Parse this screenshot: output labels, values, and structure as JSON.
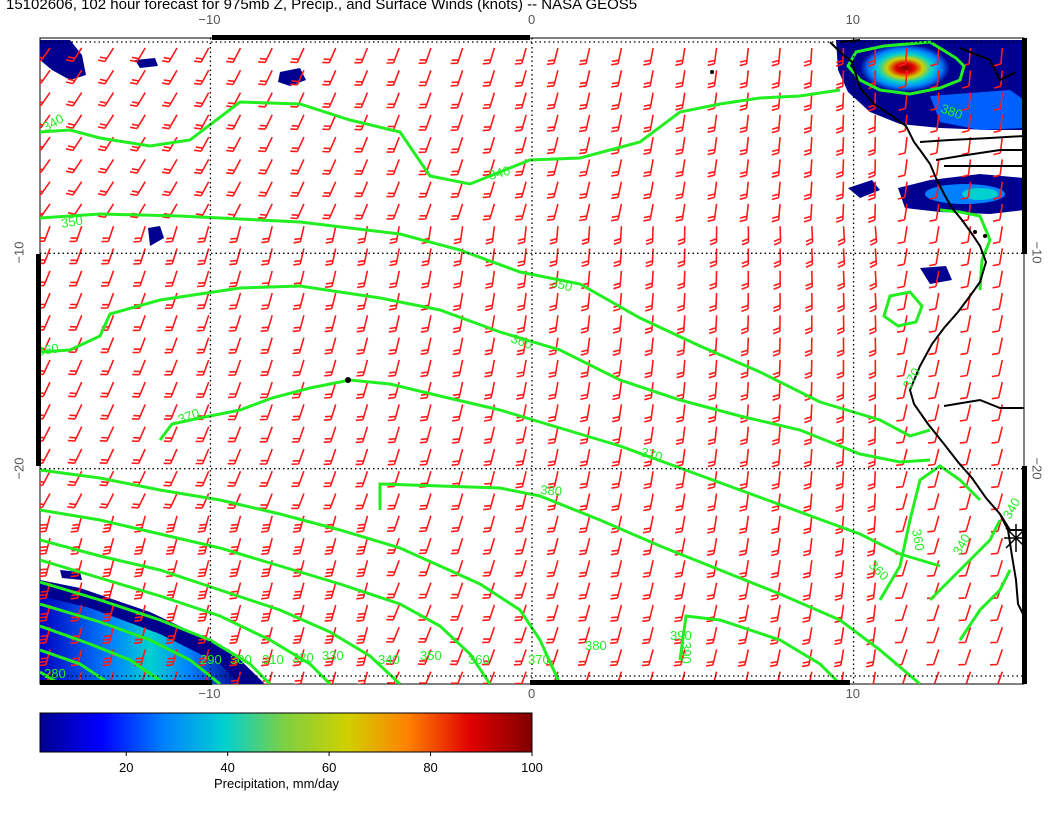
{
  "title": "15102606, 102 hour forecast for 975mb Z, Precip., and Surface Winds (knots) -- NASA GEOS5",
  "map": {
    "lon_range": [
      -15.3,
      15.3
    ],
    "lat_range": [
      -30,
      0
    ],
    "lon_ticks": [
      -10,
      0,
      10
    ],
    "lat_ticks": [
      -10,
      -20
    ],
    "lon_tick_labels": [
      "−10",
      "0",
      "10"
    ],
    "lat_tick_labels": [
      "−10",
      "−20"
    ],
    "gridlines": "dotted",
    "contour_color": "#22ee22",
    "contour_labels": [
      "340",
      "340",
      "350",
      "350",
      "360",
      "360",
      "370",
      "370",
      "380",
      "390",
      "360",
      "340",
      "340",
      "370",
      "360",
      "380",
      "290",
      "300",
      "310",
      "320",
      "330",
      "340",
      "350",
      "360",
      "370",
      "380",
      "390",
      "280"
    ],
    "wind_barb_color": "#ff1a1a",
    "coast_color": "#000000"
  },
  "colorbar": {
    "range": [
      3,
      100
    ],
    "ticks": [
      20,
      40,
      60,
      80,
      100
    ],
    "tick_labels": [
      "20",
      "40",
      "60",
      "80",
      "100"
    ],
    "label": "Precipitation, mm/day",
    "colors": [
      "#00008f",
      "#0000ff",
      "#0080ff",
      "#00d0d0",
      "#80d040",
      "#d0d000",
      "#ff8000",
      "#e00000",
      "#800000"
    ]
  }
}
